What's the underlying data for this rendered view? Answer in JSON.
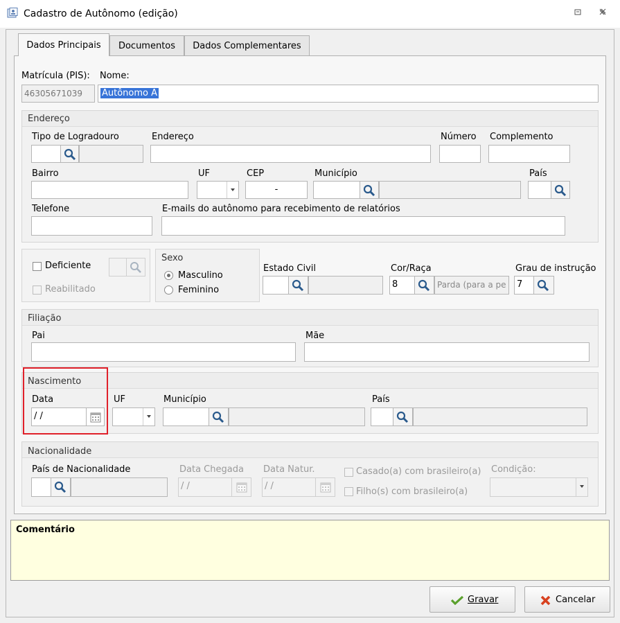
{
  "window": {
    "title": "Cadastro de Autônomo (edição)"
  },
  "tabs": [
    "Dados Principais",
    "Documentos",
    "Dados Complementares"
  ],
  "main": {
    "matricula_label": "Matrícula (PIS):",
    "matricula_value": "46305671039",
    "nome_label": "Nome:",
    "nome_value": "Autônomo A"
  },
  "endereco": {
    "title": "Endereço",
    "tipo_logradouro_label": "Tipo de Logradouro",
    "endereco_label": "Endereço",
    "numero_label": "Número",
    "complemento_label": "Complemento",
    "bairro_label": "Bairro",
    "uf_label": "UF",
    "cep_label": "CEP",
    "cep_value": "-",
    "municipio_label": "Município",
    "pais_label": "País",
    "telefone_label": "Telefone",
    "emails_label": "E-mails do autônomo para recebimento de relatórios"
  },
  "deficiente": {
    "deficiente_label": "Deficiente",
    "reabilitado_label": "Reabilitado"
  },
  "sexo": {
    "title": "Sexo",
    "masculino": "Masculino",
    "feminino": "Feminino",
    "selected": "Masculino"
  },
  "estado_civil": {
    "label": "Estado Civil"
  },
  "cor_raca": {
    "label": "Cor/Raça",
    "code": "8",
    "desc": "Parda (para a pe"
  },
  "grau_instrucao": {
    "label": "Grau de instrução",
    "code": "7"
  },
  "filiacao": {
    "title": "Filiação",
    "pai_label": "Pai",
    "mae_label": "Mãe"
  },
  "nascimento": {
    "title": "Nascimento",
    "data_label": "Data",
    "data_value": " /  /",
    "uf_label": "UF",
    "municipio_label": "Município",
    "pais_label": "País",
    "highlight_color": "#e0202a"
  },
  "nacionalidade": {
    "title": "Nacionalidade",
    "pais_label": "País de Nacionalidade",
    "data_chegada_label": "Data Chegada",
    "data_chegada_value": " /  /",
    "data_natur_label": "Data Natur.",
    "data_natur_value": " /  /",
    "casado_label": "Casado(a) com brasileiro(a)",
    "filho_label": "Filho(s) com brasileiro(a)",
    "condicao_label": "Condição:"
  },
  "comentario": {
    "label": "Comentário"
  },
  "buttons": {
    "gravar": "Gravar",
    "cancelar": "Cancelar"
  },
  "icons": {
    "search": "magnifier-icon",
    "calendar": "calendar-icon",
    "check": "check-icon",
    "cancel": "x-icon"
  }
}
